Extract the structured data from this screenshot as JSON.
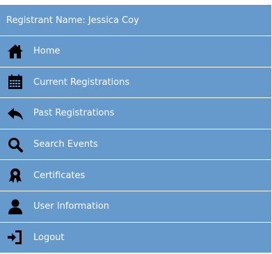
{
  "header": {
    "registrant_label": "Registrant Name: Jessica Coy"
  },
  "menu": {
    "items": [
      {
        "label": "Home",
        "icon": "home-icon"
      },
      {
        "label": "Current Registrations",
        "icon": "calendar-icon"
      },
      {
        "label": "Past Registrations",
        "icon": "reply-arrow-icon"
      },
      {
        "label": "Search Events",
        "icon": "search-icon"
      },
      {
        "label": "Certificates",
        "icon": "certificate-icon"
      },
      {
        "label": "User Information",
        "icon": "user-icon"
      },
      {
        "label": "Logout",
        "icon": "logout-icon"
      }
    ]
  },
  "colors": {
    "menu_background": "#6699cc",
    "divider": "#ffffff",
    "text": "#ffffff",
    "icon": "#000000"
  }
}
